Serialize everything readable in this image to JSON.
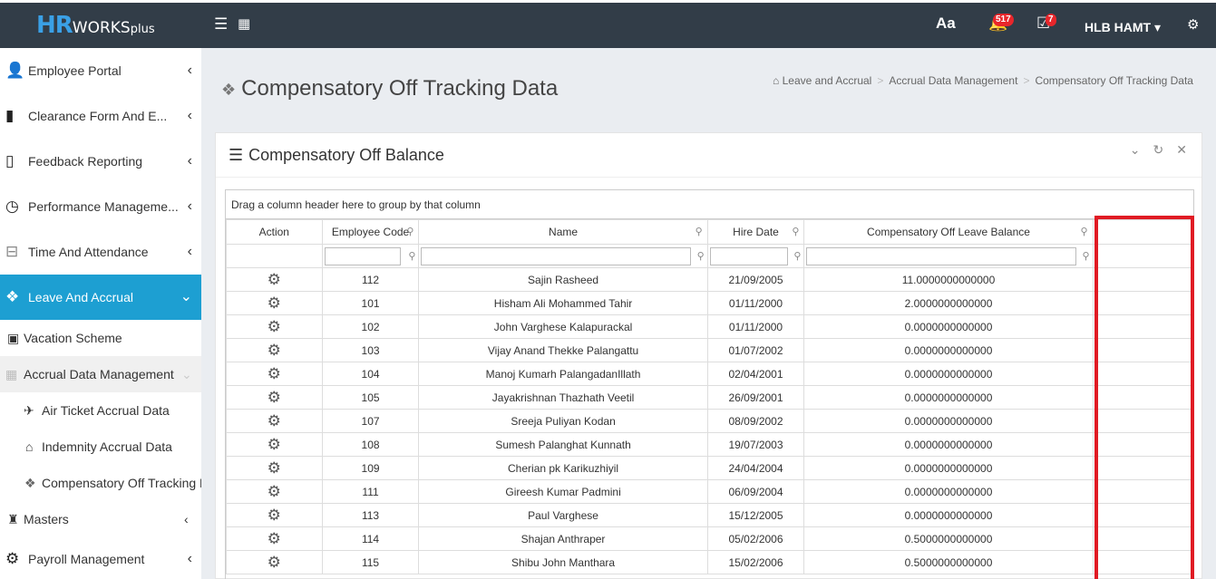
{
  "topbar": {
    "logo_hr": "HR",
    "logo_works": "WORKS",
    "logo_plus": "plus",
    "font_icon": "Aa",
    "notifications_count": "517",
    "tasks_count": "7",
    "user_label": "HLB HAMT",
    "icons": [
      "hamburger-icon",
      "grid-icon",
      "bell-icon",
      "tasks-icon",
      "settings-gears-icon"
    ]
  },
  "sidebar": {
    "items": [
      {
        "label": "Employee Portal",
        "icon": "user-icon"
      },
      {
        "label": "Clearance Form And E...",
        "icon": "clearance-icon"
      },
      {
        "label": "Feedback Reporting",
        "icon": "notebook-icon"
      },
      {
        "label": "Performance Manageme...",
        "icon": "gauge-icon"
      },
      {
        "label": "Time And Attendance",
        "icon": "time-icon"
      },
      {
        "label": "Leave And Accrual",
        "icon": "leave-icon"
      }
    ],
    "sub": {
      "vacation": "Vacation Scheme",
      "accrual": "Accrual Data Management",
      "air_ticket": "Air Ticket Accrual Data",
      "indemnity": "Indemnity Accrual Data",
      "comp_off": "Compensatory Off Tracking Data"
    },
    "masters": "Masters",
    "payroll": "Payroll Management"
  },
  "page": {
    "title": "Compensatory Off Tracking Data",
    "breadcrumb": [
      "Leave and Accrual",
      "Accrual Data Management",
      "Compensatory Off Tracking Data"
    ]
  },
  "panel": {
    "title": "Compensatory Off Balance",
    "group_hint": "Drag a column header here to group by that column",
    "columns": [
      "Action",
      "Employee Code",
      "Name",
      "Hire Date",
      "Compensatory Off Leave Balance"
    ],
    "rows": [
      {
        "code": "112",
        "name": "Sajin Rasheed",
        "hire": "21/09/2005",
        "balance": "11.0000000000000"
      },
      {
        "code": "101",
        "name": "Hisham Ali Mohammed Tahir",
        "hire": "01/11/2000",
        "balance": "2.0000000000000"
      },
      {
        "code": "102",
        "name": "John Varghese Kalapurackal",
        "hire": "01/11/2000",
        "balance": "0.0000000000000"
      },
      {
        "code": "103",
        "name": "Vijay Anand Thekke Palangattu",
        "hire": "01/07/2002",
        "balance": "0.0000000000000"
      },
      {
        "code": "104",
        "name": "Manoj Kumarh PalangadanIllath",
        "hire": "02/04/2001",
        "balance": "0.0000000000000"
      },
      {
        "code": "105",
        "name": "Jayakrishnan Thazhath Veetil",
        "hire": "26/09/2001",
        "balance": "0.0000000000000"
      },
      {
        "code": "107",
        "name": "Sreeja Puliyan Kodan",
        "hire": "08/09/2002",
        "balance": "0.0000000000000"
      },
      {
        "code": "108",
        "name": "Sumesh Palanghat Kunnath",
        "hire": "19/07/2003",
        "balance": "0.0000000000000"
      },
      {
        "code": "109",
        "name": "Cherian pk Karikuzhiyil",
        "hire": "24/04/2004",
        "balance": "0.0000000000000"
      },
      {
        "code": "111",
        "name": "Gireesh Kumar Padmini",
        "hire": "06/09/2004",
        "balance": "0.0000000000000"
      },
      {
        "code": "113",
        "name": "Paul Varghese",
        "hire": "15/12/2005",
        "balance": "0.0000000000000"
      },
      {
        "code": "114",
        "name": "Shajan Anthraper",
        "hire": "05/02/2006",
        "balance": "0.5000000000000"
      },
      {
        "code": "115",
        "name": "Shibu John Manthara",
        "hire": "15/02/2006",
        "balance": "0.5000000000000"
      }
    ]
  },
  "colors": {
    "topbar": "#323d48",
    "accent": "#1d9fd2",
    "highlight": "#e01b24"
  }
}
